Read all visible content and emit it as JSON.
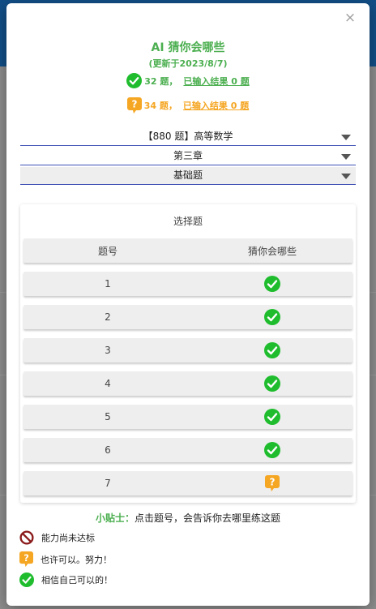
{
  "modal": {
    "title": "AI 猜你会哪些",
    "subtitle": "(更新于2023/8/7)",
    "stats": {
      "mastered_count": "32 题，",
      "mastered_link": "已输入结果 0 题",
      "maybe_count": "34 题，",
      "maybe_link": "已输入结果 0 题"
    },
    "selects": {
      "book": "【880 题】高等数学",
      "chapter": "第三章",
      "level": "基础题"
    },
    "table": {
      "section_title": "选择题",
      "headers": [
        "题号",
        "猜你会哪些"
      ],
      "rows": [
        {
          "number": "1",
          "status": "check"
        },
        {
          "number": "2",
          "status": "check"
        },
        {
          "number": "3",
          "status": "check"
        },
        {
          "number": "4",
          "status": "check"
        },
        {
          "number": "5",
          "status": "check"
        },
        {
          "number": "6",
          "status": "check"
        },
        {
          "number": "7",
          "status": "question"
        }
      ]
    },
    "tip": {
      "label": "小贴士：",
      "text": "点击题号，会告诉你去哪里练这题"
    },
    "legend": [
      {
        "icon": "prohibited-icon",
        "label": "能力尚未达标"
      },
      {
        "icon": "question-bubble-icon",
        "label": "也许可以。努力！"
      },
      {
        "icon": "check-circle-icon",
        "label": "相信自己可以的！"
      }
    ],
    "close_symbol": "×"
  },
  "colors": {
    "green": "#4caf50",
    "check_green": "#1fbd2e",
    "orange": "#f5a623",
    "underline_blue": "#3f51b5",
    "header_blue": "#124f87"
  }
}
